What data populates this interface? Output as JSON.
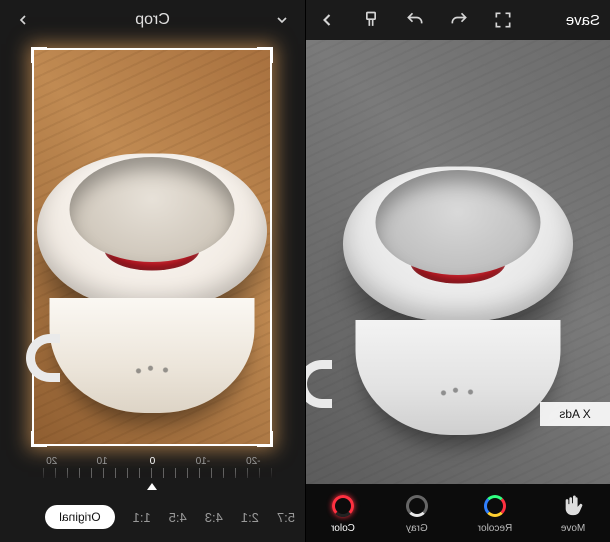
{
  "left": {
    "save_label": "Save",
    "ads_label": "X Ads",
    "tools": {
      "move": {
        "label": "Move"
      },
      "recolor": {
        "label": "Recolor"
      },
      "gray": {
        "label": "Gray"
      },
      "color": {
        "label": "Color"
      }
    }
  },
  "right": {
    "title": "Crop",
    "dial": {
      "m20": "-20",
      "m10": "-10",
      "zero": "0",
      "p10": "10",
      "p20": "20"
    },
    "ratios": {
      "r57": "5:7",
      "r21": "2:1",
      "r43": "4:3",
      "r45": "4:5",
      "r11": "1:1",
      "original": "Original"
    }
  }
}
